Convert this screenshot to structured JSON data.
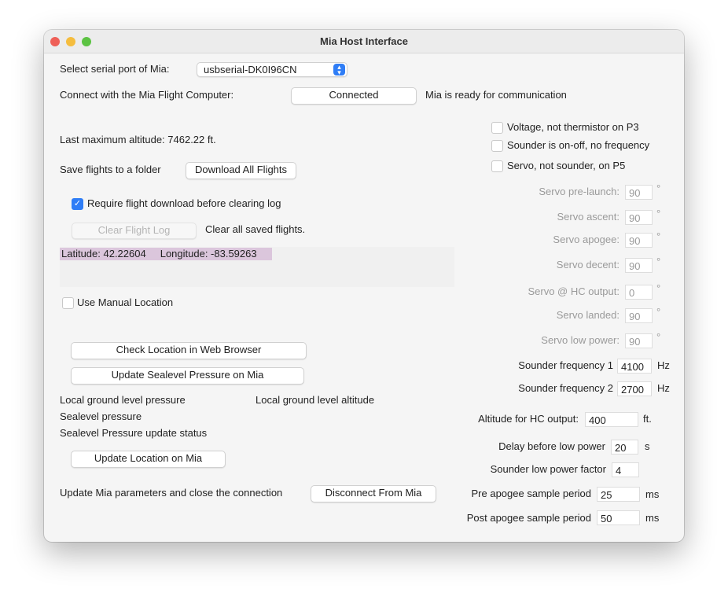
{
  "window": {
    "title": "Mia Host Interface"
  },
  "port": {
    "label": "Select serial port of Mia:",
    "value": "usbserial-DK0I96CN"
  },
  "connect": {
    "label": "Connect with the Mia Flight Computer:",
    "button": "Connected",
    "status": "Mia is ready for communication"
  },
  "altitude": "Last maximum altitude: 7462.22 ft.",
  "save": {
    "label": "Save flights to a folder",
    "button": "Download All Flights"
  },
  "require_download": {
    "label": "Require flight download before clearing log",
    "checked": true
  },
  "clear": {
    "button": "Clear Flight Log",
    "label": "Clear all saved flights."
  },
  "location": {
    "latitude": "Latitude: 42.22604",
    "longitude": "Longitude: -83.59263"
  },
  "manual_location": {
    "label": "Use Manual Location",
    "checked": false
  },
  "buttons": {
    "check_location": "Check Location in Web Browser",
    "update_sealevel": "Update Sealevel Pressure on Mia",
    "update_location": "Update Location on Mia",
    "disconnect": "Disconnect From Mia"
  },
  "info": {
    "ground_pressure": "Local ground level pressure",
    "ground_altitude": "Local ground level altitude",
    "sealevel": "Sealevel pressure",
    "status": "Sealevel Pressure update status",
    "update_params": "Update Mia parameters and close the connection"
  },
  "options": [
    {
      "label": "Voltage, not thermistor on P3",
      "checked": false
    },
    {
      "label": "Sounder is on-off, no frequency",
      "checked": false
    },
    {
      "label": "Servo, not sounder, on P5",
      "checked": false
    }
  ],
  "servo": [
    {
      "label": "Servo pre-launch:",
      "value": "90",
      "unit": "°"
    },
    {
      "label": "Servo ascent:",
      "value": "90",
      "unit": "°"
    },
    {
      "label": "Servo apogee:",
      "value": "90",
      "unit": "°"
    },
    {
      "label": "Servo decent:",
      "value": "90",
      "unit": "°"
    },
    {
      "label": "Servo @ HC output:",
      "value": "0",
      "unit": "°"
    },
    {
      "label": "Servo landed:",
      "value": "90",
      "unit": "°"
    },
    {
      "label": "Servo low power:",
      "value": "90",
      "unit": "°"
    }
  ],
  "params": {
    "freq1": {
      "label": "Sounder frequency 1",
      "value": "4100",
      "unit": "Hz"
    },
    "freq2": {
      "label": "Sounder frequency 2",
      "value": "2700",
      "unit": "Hz"
    },
    "hc_alt": {
      "label": "Altitude for HC output:",
      "value": "400",
      "unit": "ft."
    },
    "delay": {
      "label": "Delay before low power",
      "value": "20",
      "unit": "s"
    },
    "factor": {
      "label": "Sounder low power factor",
      "value": "4"
    },
    "pre": {
      "label": "Pre apogee sample period",
      "value": "25",
      "unit": "ms"
    },
    "post": {
      "label": "Post apogee sample period",
      "value": "50",
      "unit": "ms"
    }
  }
}
